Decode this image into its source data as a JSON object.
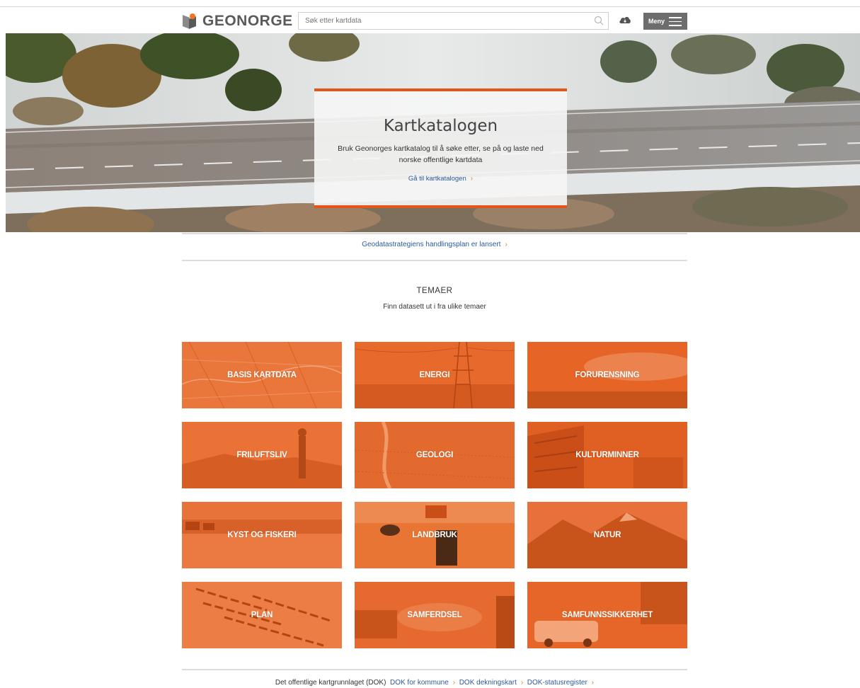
{
  "header": {
    "logo_text": "GEONORGE",
    "search_placeholder": "Søk etter kartdata",
    "menu_label": "Meny"
  },
  "hero": {
    "title": "Kartkatalogen",
    "description": "Bruk Geonorges kartkatalog til å søke etter, se på og laste ned norske offentlige kartdata",
    "link_label": "Gå til kartkatalogen"
  },
  "news": {
    "link_label": "Geodatastrategiens handlingsplan er lansert"
  },
  "themes": {
    "title": "TEMAER",
    "subtitle": "Finn datasett ut i fra ulike temaer",
    "items": [
      {
        "label": "BASIS KARTDATA"
      },
      {
        "label": "ENERGI"
      },
      {
        "label": "FORURENSNING"
      },
      {
        "label": "FRILUFTSLIV"
      },
      {
        "label": "GEOLOGI"
      },
      {
        "label": "KULTURMINNER"
      },
      {
        "label": "KYST OG FISKERI"
      },
      {
        "label": "LANDBRUK"
      },
      {
        "label": "NATUR"
      },
      {
        "label": "PLAN"
      },
      {
        "label": "SAMFERDSEL"
      },
      {
        "label": "SAMFUNNSSIKKERHET"
      }
    ]
  },
  "footer": {
    "prefix": "Det offentlige kartgrunnlaget (DOK)",
    "links": [
      {
        "label": "DOK for kommune"
      },
      {
        "label": "DOK dekningskart"
      },
      {
        "label": "DOK-statusregister"
      }
    ]
  },
  "colors": {
    "accent": "#ee7623",
    "tile_overlay": "#e8682a",
    "link": "#2c5a9e"
  }
}
